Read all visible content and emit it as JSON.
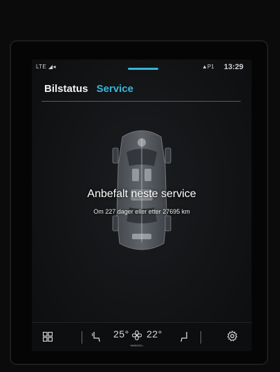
{
  "status_bar": {
    "network": "LTE",
    "ap_label": "▲P1",
    "time": "13:29"
  },
  "tabs": [
    {
      "label": "Bilstatus",
      "active": false
    },
    {
      "label": "Service",
      "active": true
    }
  ],
  "colors": {
    "accent": "#3ab6dc",
    "text": "#f2f2f2",
    "background": "#121315"
  },
  "service": {
    "title": "Anbefalt neste service",
    "detail": "Om 227 dager eller etter 27695 km"
  },
  "bottom_bar": {
    "home_icon": "grid-icon",
    "left_seat_icon": "seat-heating-left-icon",
    "left_temp": "25°",
    "fan_icon": "fan-icon",
    "climate_mode": "MANUELL",
    "right_temp": "22°",
    "right_seat_icon": "seat-heating-right-icon",
    "settings_icon": "gear-icon"
  }
}
